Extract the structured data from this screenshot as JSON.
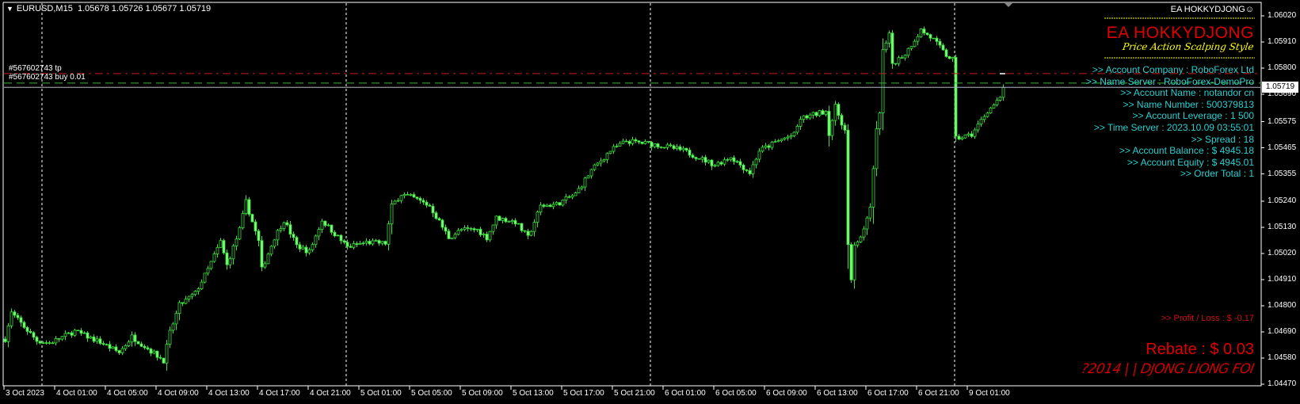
{
  "header": {
    "menu_icon": "triangle-down-icon",
    "symbol": "EURUSD,M15",
    "ohlc": "1.05678 1.05726 1.05677 1.05719"
  },
  "orders": {
    "tp_label": "#567602743 tp",
    "buy_label": "#567602743 buy 0.01",
    "tp_price": 1.05777,
    "buy_price": 1.05737,
    "tp_line_color": "#c81e1e",
    "buy_line_color": "#3cb43c"
  },
  "current_price": {
    "value": 1.05719,
    "label": "1.05719"
  },
  "panel": {
    "ea_name_small": "EA HOKKYDJONG",
    "smiley_icon": "smiley-icon",
    "ea_name_big": "EA HOKKYDJONG",
    "tagline": "Price Action Scalping Style",
    "info_lines": [
      ">> Account Company : RoboForex Ltd",
      ">> Name Server  : RoboForex-DemoPro",
      ">> Account Name  : notandor cn",
      ">> Name Number  : 500379813",
      ">> Account Leverage  : 1 500",
      ">> Time Server  : 2023.10.09 03:55:01",
      ">> Spread  : 18",
      ">> Account Balance  : $ 4945.18",
      ">> Account Equity  : $ 4945.01",
      ">> Order Total  : 1"
    ],
    "profit_loss": ">> Profit / Loss  : $ -0.17",
    "rebate": "Rebate  : $ 0.03",
    "signature": "?2014 | | DJONG LIONG FOI"
  },
  "price_axis": {
    "max": 1.0602,
    "min": 1.0447,
    "ticks": [
      "1.06020",
      "1.05910",
      "1.05800",
      "1.05690",
      "1.05575",
      "1.05465",
      "1.05355",
      "1.05240",
      "1.05130",
      "1.05020",
      "1.04910",
      "1.04800",
      "1.04690",
      "1.04580",
      "1.04470"
    ]
  },
  "time_axis": {
    "labels": [
      "3 Oct 2023",
      "4 Oct 01:00",
      "4 Oct 05:00",
      "4 Oct 09:00",
      "4 Oct 13:00",
      "4 Oct 17:00",
      "4 Oct 21:00",
      "5 Oct 01:00",
      "5 Oct 05:00",
      "5 Oct 09:00",
      "5 Oct 13:00",
      "5 Oct 17:00",
      "5 Oct 21:00",
      "6 Oct 01:00",
      "6 Oct 05:00",
      "6 Oct 09:00",
      "6 Oct 13:00",
      "6 Oct 17:00",
      "6 Oct 21:00",
      "9 Oct 01:00"
    ],
    "day_separators": [
      "4 Oct 00:00",
      "5 Oct 00:00",
      "6 Oct 00:00",
      "9 Oct 00:00"
    ]
  },
  "colors": {
    "candle": "#3ddc3d",
    "info_text": "#2ccfd0",
    "brand_red": "#e00000",
    "tagline": "#ffff00"
  },
  "chart_data": {
    "type": "candlestick",
    "timeframe": "M15",
    "price_path": [
      [
        "2023-10-03 21:00",
        1.0466
      ],
      [
        "2023-10-03 21:30",
        1.0477
      ],
      [
        "2023-10-03 23:30",
        1.04653
      ],
      [
        "2023-10-04 00:30",
        1.04643
      ],
      [
        "2023-10-04 02:30",
        1.04693
      ],
      [
        "2023-10-04 04:30",
        1.04647
      ],
      [
        "2023-10-04 06:00",
        1.04603
      ],
      [
        "2023-10-04 07:00",
        1.0467
      ],
      [
        "2023-10-04 08:30",
        1.0461
      ],
      [
        "2023-10-04 09:30",
        1.0457
      ],
      [
        "2023-10-04 10:00",
        1.04687
      ],
      [
        "2023-10-04 10:45",
        1.04803
      ],
      [
        "2023-10-04 12:00",
        1.04853
      ],
      [
        "2023-10-04 13:00",
        1.04953
      ],
      [
        "2023-10-04 14:00",
        1.0507
      ],
      [
        "2023-10-04 14:30",
        1.0497
      ],
      [
        "2023-10-04 15:30",
        1.0512
      ],
      [
        "2023-10-04 16:00",
        1.05237
      ],
      [
        "2023-10-04 17:00",
        1.0507
      ],
      [
        "2023-10-04 17:15",
        1.04953
      ],
      [
        "2023-10-04 18:15",
        1.05087
      ],
      [
        "2023-10-04 19:00",
        1.0516
      ],
      [
        "2023-10-04 20:00",
        1.05053
      ],
      [
        "2023-10-04 21:00",
        1.05027
      ],
      [
        "2023-10-04 22:00",
        1.0516
      ],
      [
        "2023-10-04 23:00",
        1.05103
      ],
      [
        "2023-10-05 00:00",
        1.05047
      ],
      [
        "2023-10-05 01:30",
        1.05067
      ],
      [
        "2023-10-05 03:00",
        1.05063
      ],
      [
        "2023-10-05 03:30",
        1.0522
      ],
      [
        "2023-10-05 04:15",
        1.0527
      ],
      [
        "2023-10-05 05:15",
        1.05253
      ],
      [
        "2023-10-05 06:30",
        1.0522
      ],
      [
        "2023-10-05 08:00",
        1.05087
      ],
      [
        "2023-10-05 09:00",
        1.0512
      ],
      [
        "2023-10-05 10:15",
        1.0512
      ],
      [
        "2023-10-05 11:00",
        1.05087
      ],
      [
        "2023-10-05 11:45",
        1.0517
      ],
      [
        "2023-10-05 13:15",
        1.05153
      ],
      [
        "2023-10-05 14:15",
        1.05087
      ],
      [
        "2023-10-05 15:15",
        1.0522
      ],
      [
        "2023-10-05 16:30",
        1.05227
      ],
      [
        "2023-10-05 18:00",
        1.0527
      ],
      [
        "2023-10-05 19:15",
        1.0537
      ],
      [
        "2023-10-05 20:45",
        1.05453
      ],
      [
        "2023-10-05 22:00",
        1.05493
      ],
      [
        "2023-10-06 00:30",
        1.05477
      ],
      [
        "2023-10-06 02:30",
        1.05453
      ],
      [
        "2023-10-06 05:00",
        1.05393
      ],
      [
        "2023-10-06 06:15",
        1.05427
      ],
      [
        "2023-10-06 07:45",
        1.0536
      ],
      [
        "2023-10-06 08:30",
        1.05453
      ],
      [
        "2023-10-06 10:15",
        1.055
      ],
      [
        "2023-10-06 11:15",
        1.0552
      ],
      [
        "2023-10-06 11:45",
        1.05587
      ],
      [
        "2023-10-06 13:45",
        1.0562
      ],
      [
        "2023-10-06 14:00",
        1.05527
      ],
      [
        "2023-10-06 14:30",
        1.05637
      ],
      [
        "2023-10-06 15:15",
        1.05537
      ],
      [
        "2023-10-06 15:30",
        1.05053
      ],
      [
        "2023-10-06 15:45",
        1.049
      ],
      [
        "2023-10-06 16:00",
        1.05053
      ],
      [
        "2023-10-06 16:45",
        1.05113
      ],
      [
        "2023-10-06 17:15",
        1.0522
      ],
      [
        "2023-10-06 17:30",
        1.0537
      ],
      [
        "2023-10-06 17:45",
        1.05537
      ],
      [
        "2023-10-06 18:00",
        1.0562
      ],
      [
        "2023-10-06 18:15",
        1.0587
      ],
      [
        "2023-10-06 18:45",
        1.05937
      ],
      [
        "2023-10-06 19:00",
        1.0582
      ],
      [
        "2023-10-06 20:00",
        1.0586
      ],
      [
        "2023-10-06 21:15",
        1.0596
      ],
      [
        "2023-10-06 22:15",
        1.0592
      ],
      [
        "2023-10-06 23:15",
        1.05853
      ],
      [
        "2023-10-06 23:45",
        1.05837
      ],
      [
        "2023-10-09 00:00",
        1.05503
      ],
      [
        "2023-10-09 01:15",
        1.0552
      ],
      [
        "2023-10-09 02:30",
        1.0562
      ],
      [
        "2023-10-09 03:30",
        1.0567
      ],
      [
        "2023-10-09 03:45",
        1.05719
      ]
    ]
  }
}
